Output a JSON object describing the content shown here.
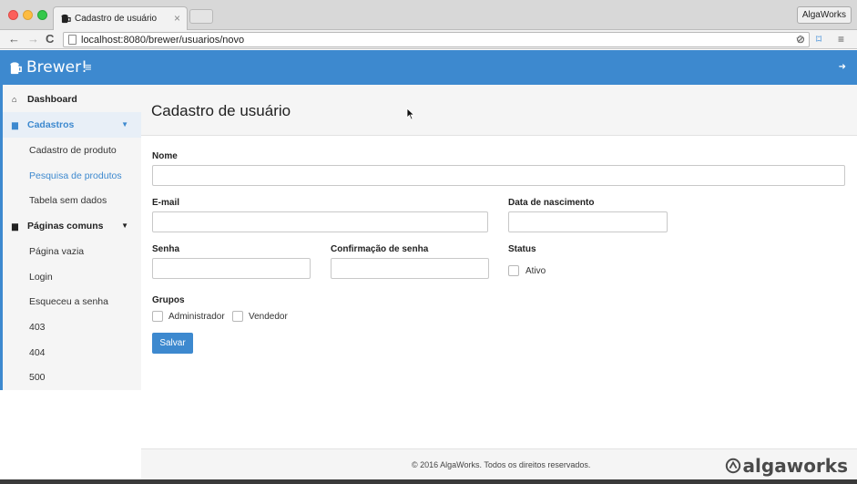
{
  "browser": {
    "tab_title": "Cadastro de usuário",
    "tab_close": "×",
    "profile": "AlgaWorks",
    "url": "localhost:8080/brewer/usuarios/novo"
  },
  "header": {
    "brand": "Brewer!",
    "accent_color": "#3d89cf"
  },
  "sidebar": {
    "items": [
      {
        "label": "Dashboard",
        "icon": "home-icon"
      },
      {
        "label": "Cadastros",
        "icon": "file-icon"
      },
      {
        "label": "Cadastro de produto"
      },
      {
        "label": "Pesquisa de produtos"
      },
      {
        "label": "Tabela sem dados"
      },
      {
        "label": "Páginas comuns",
        "icon": "file-icon"
      },
      {
        "label": "Página vazia"
      },
      {
        "label": "Login"
      },
      {
        "label": "Esqueceu a senha"
      },
      {
        "label": "403"
      },
      {
        "label": "404"
      },
      {
        "label": "500"
      }
    ]
  },
  "main": {
    "title": "Cadastro de usuário",
    "form": {
      "nome_label": "Nome",
      "email_label": "E-mail",
      "nascimento_label": "Data de nascimento",
      "senha_label": "Senha",
      "confirmacao_label": "Confirmação de senha",
      "status_label": "Status",
      "ativo_label": "Ativo",
      "grupos_label": "Grupos",
      "grupos": [
        "Administrador",
        "Vendedor"
      ],
      "save_label": "Salvar"
    }
  },
  "footer": {
    "copyright": "© 2016 AlgaWorks. Todos os direitos reservados.",
    "logo_text": "algaworks"
  }
}
